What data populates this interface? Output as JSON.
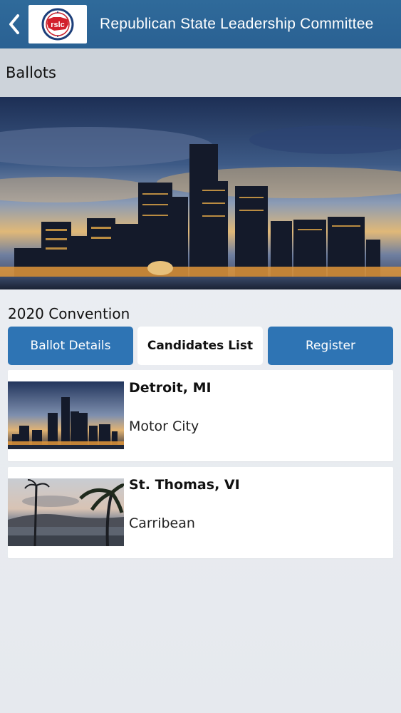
{
  "header": {
    "title": "Republican State Leadership Committee",
    "logo_text": "rslc",
    "back_icon": "chevron-left-icon"
  },
  "section": {
    "title": "Ballots"
  },
  "convention": {
    "title": "2020 Convention"
  },
  "tabs": [
    {
      "label": "Ballot Details",
      "state": "default"
    },
    {
      "label": "Candidates List",
      "state": "selected"
    },
    {
      "label": "Register",
      "state": "default"
    }
  ],
  "locations": [
    {
      "name": "Detroit, MI",
      "subtitle": "Motor City"
    },
    {
      "name": "St. Thomas, VI",
      "subtitle": "Carribean"
    }
  ],
  "colors": {
    "appbar": "#2f6a9a",
    "tab_blue": "#2e74b4",
    "section_bg": "#cdd3da"
  }
}
